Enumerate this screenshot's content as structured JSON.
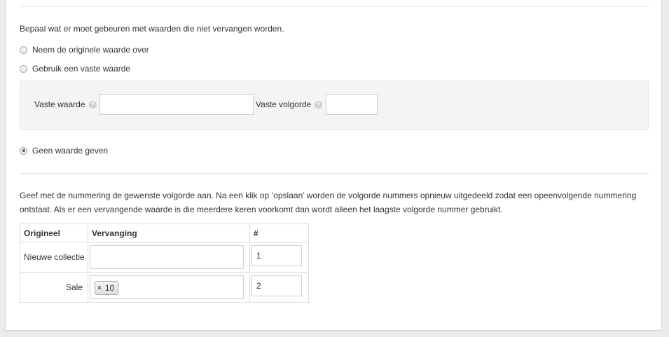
{
  "intro": "Bepaal wat er moet gebeuren met waarden die niet vervangen worden.",
  "options": {
    "keep_original": "Neem de originele waarde over",
    "use_fixed": "Gebruik een vaste waarde",
    "no_value": "Geen waarde geven",
    "selected": "no_value"
  },
  "fixed": {
    "value_label": "Vaste waarde",
    "order_label": "Vaste volgorde",
    "value": "",
    "order": "",
    "help_glyph": "?"
  },
  "description_line1": "Geef met de nummering de gewenste volgorde aan. Na een klik op ‘opslaan’ worden de volgorde nummers opnieuw uitgedeeld zodat een opeenvolgende nummering",
  "description_line2": "ontstaat. Als er een vervangende waarde is die meerdere keren voorkomt dan wordt alleen het laagste volgorde nummer gebruikt.",
  "table": {
    "headers": [
      "Origineel",
      "Vervanging",
      "#"
    ],
    "rows": [
      {
        "original": "Nieuwe collectie",
        "replacement_tag": "",
        "order": "1"
      },
      {
        "original": "Sale",
        "replacement_tag": "10",
        "order": "2"
      }
    ],
    "tag_remove_glyph": "×"
  }
}
